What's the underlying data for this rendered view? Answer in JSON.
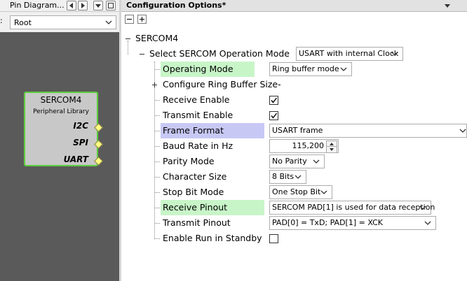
{
  "left_panel": {
    "tab_title": "Pin Diagram...",
    "view_label": ":",
    "view_select": "Root",
    "block": {
      "title": "SERCOM4",
      "subtitle": "Peripheral Library",
      "pins": [
        "I2C",
        "SPI",
        "UART"
      ]
    }
  },
  "right_panel": {
    "tab_title": "Configuration Options*",
    "tree": {
      "root": "SERCOM4",
      "mode_label": "Select SERCOM Operation Mode",
      "mode_value": "USART with internal Clock",
      "rows": [
        {
          "label": "Operating Mode",
          "value": "Ring buffer mode",
          "type": "select",
          "highlight": "green"
        },
        {
          "label": "Configure Ring Buffer Size-",
          "type": "expand"
        },
        {
          "label": "Receive Enable",
          "type": "checkbox",
          "checked": true
        },
        {
          "label": "Transmit Enable",
          "type": "checkbox",
          "checked": true
        },
        {
          "label": "Frame Format",
          "value": "USART frame",
          "type": "select",
          "highlight": "blue"
        },
        {
          "label": "Baud Rate in Hz",
          "value": "115,200",
          "type": "spin"
        },
        {
          "label": "Parity Mode",
          "value": "No Parity",
          "type": "select"
        },
        {
          "label": "Character Size",
          "value": "8 Bits",
          "type": "select"
        },
        {
          "label": "Stop Bit Mode",
          "value": "One Stop Bit",
          "type": "select"
        },
        {
          "label": "Receive Pinout",
          "value": "SERCOM PAD[1] is used for data reception",
          "type": "select",
          "highlight": "green"
        },
        {
          "label": "Transmit Pinout",
          "value": "PAD[0] = TxD; PAD[1] = XCK",
          "type": "select"
        },
        {
          "label": "Enable Run in Standby",
          "type": "checkbox",
          "checked": false
        }
      ]
    }
  },
  "colors": {
    "canvas": "#5a5a5a",
    "block_border": "#5ccd3c",
    "highlight_green": "#c8f5c8",
    "highlight_blue": "#c8c8f5"
  }
}
